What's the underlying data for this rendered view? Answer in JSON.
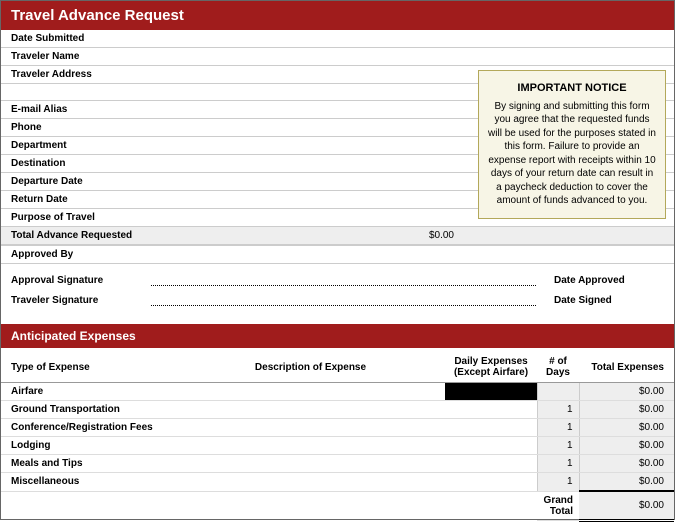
{
  "title": "Travel Advance Request",
  "notice": {
    "heading": "IMPORTANT NOTICE",
    "body": "By signing and submitting this form you agree that the requested funds will be used for the purposes stated in this form. Failure to provide an expense report with receipts within 10 days of your return date can result in a paycheck deduction to cover the amount of funds advanced to you."
  },
  "form": {
    "date_submitted": {
      "label": "Date Submitted",
      "value": ""
    },
    "traveler_name": {
      "label": "Traveler Name",
      "value": ""
    },
    "traveler_address": {
      "label": "Traveler Address",
      "value": ""
    },
    "email_alias": {
      "label": "E-mail Alias",
      "value": ""
    },
    "phone": {
      "label": "Phone",
      "value": ""
    },
    "department": {
      "label": "Department",
      "value": ""
    },
    "destination": {
      "label": "Destination",
      "value": ""
    },
    "departure_date": {
      "label": "Departure Date",
      "value": ""
    },
    "return_date": {
      "label": "Return Date",
      "value": ""
    },
    "purpose": {
      "label": "Purpose of Travel",
      "value": ""
    },
    "total_requested": {
      "label": "Total Advance Requested",
      "value": "$0.00"
    },
    "approved_by": {
      "label": "Approved By",
      "value": ""
    }
  },
  "signatures": {
    "approval": {
      "label": "Approval Signature",
      "date_label": "Date Approved"
    },
    "traveler": {
      "label": "Traveler Signature",
      "date_label": "Date Signed"
    }
  },
  "expenses": {
    "heading": "Anticipated Expenses",
    "columns": {
      "type": "Type of Expense",
      "desc": "Description of Expense",
      "daily": "Daily Expenses (Except Airfare)",
      "days": "# of Days",
      "total": "Total Expenses"
    },
    "rows": [
      {
        "type": "Airfare",
        "desc": "",
        "daily": "",
        "days": "",
        "total": "$0.00",
        "black_daily": true
      },
      {
        "type": "Ground Transportation",
        "desc": "",
        "daily": "",
        "days": "1",
        "total": "$0.00"
      },
      {
        "type": "Conference/Registration Fees",
        "desc": "",
        "daily": "",
        "days": "1",
        "total": "$0.00"
      },
      {
        "type": "Lodging",
        "desc": "",
        "daily": "",
        "days": "1",
        "total": "$0.00"
      },
      {
        "type": "Meals and Tips",
        "desc": "",
        "daily": "",
        "days": "1",
        "total": "$0.00"
      },
      {
        "type": "Miscellaneous",
        "desc": "",
        "daily": "",
        "days": "1",
        "total": "$0.00"
      }
    ],
    "grand_total": {
      "label": "Grand Total",
      "value": "$0.00"
    }
  }
}
